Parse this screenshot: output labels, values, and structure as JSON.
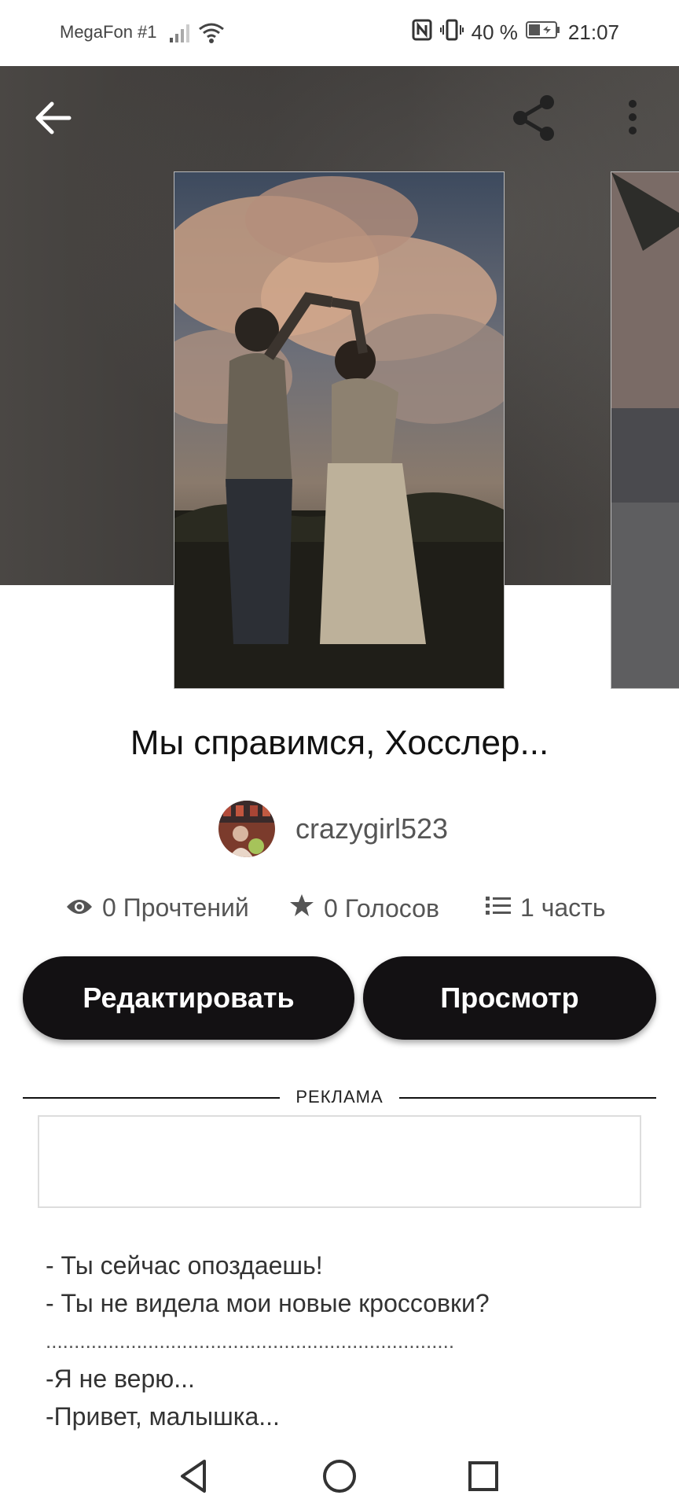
{
  "status_bar": {
    "carrier": "MegaFon #1",
    "battery": "40 %",
    "time": "21:07"
  },
  "book": {
    "title": "Мы справимся, Хосслер...",
    "author": "crazygirl523"
  },
  "stats": {
    "reads": "0 Прочтений",
    "votes": "0 Голосов",
    "parts": "1 часть"
  },
  "actions": {
    "edit_label": "Редактировать",
    "preview_label": "Просмотр"
  },
  "ad": {
    "label": "РЕКЛАМА"
  },
  "story_lines": [
    "- Ты сейчас опоздаешь!",
    "- Ты не видела мои новые кроссовки?",
    "........................................................................",
    "-Я не верю...",
    "-Привет, малышка..."
  ],
  "icons": {
    "back": "arrow-left-icon",
    "share": "share-icon",
    "more": "more-vertical-icon",
    "reads": "eye-icon",
    "votes": "star-icon",
    "parts": "list-icon"
  }
}
